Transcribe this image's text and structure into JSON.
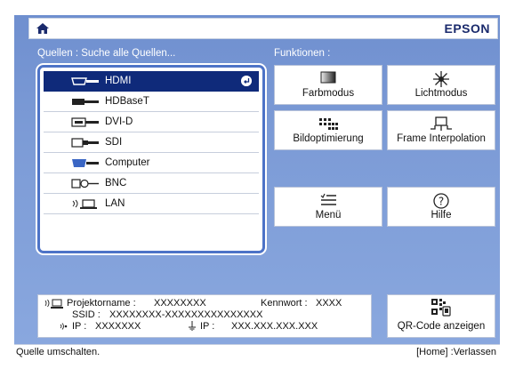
{
  "header": {
    "brand": "EPSON"
  },
  "sources": {
    "label": "Quellen : Suche alle Quellen...",
    "items": [
      {
        "label": "HDMI",
        "icon": "hdmi-connector-icon",
        "selected": true
      },
      {
        "label": "HDBaseT",
        "icon": "hdbaset-connector-icon"
      },
      {
        "label": "DVI-D",
        "icon": "dvi-connector-icon"
      },
      {
        "label": "SDI",
        "icon": "sdi-connector-icon"
      },
      {
        "label": "Computer",
        "icon": "vga-connector-icon"
      },
      {
        "label": "BNC",
        "icon": "bnc-connector-icon"
      },
      {
        "label": "LAN",
        "icon": "lan-icon"
      }
    ]
  },
  "functions": {
    "label": "Funktionen :",
    "buttons": [
      {
        "label": "Farbmodus",
        "icon": "color-mode-icon"
      },
      {
        "label": "Lichtmodus",
        "icon": "light-mode-icon"
      },
      {
        "label": "Bildoptimierung",
        "icon": "image-enhancement-icon"
      },
      {
        "label": "Frame Interpolation",
        "icon": "frame-interpolation-icon"
      },
      {
        "label": "Menü",
        "icon": "menu-icon"
      },
      {
        "label": "Hilfe",
        "icon": "help-icon"
      }
    ]
  },
  "info": {
    "projector_name_label": "Projektorname :",
    "projector_name_value": "XXXXXXXX",
    "password_label": "Kennwort :",
    "password_value": "XXXX",
    "ssid_label": "SSID :",
    "ssid_value": "XXXXXXXX-XXXXXXXXXXXXXXX",
    "ip_label": "IP :",
    "ip_value": "XXXXXXX",
    "wired_ip_label": "IP :",
    "wired_ip_value": "XXX.XXX.XXX.XXX"
  },
  "qr": {
    "label": "QR-Code anzeigen"
  },
  "status": {
    "left": "Quelle umschalten.",
    "right": "[Home] :Verlassen"
  },
  "colors": {
    "accent": "#0f2a7a",
    "background": "#7c9bd6",
    "panel_border": "#4d73c7"
  }
}
